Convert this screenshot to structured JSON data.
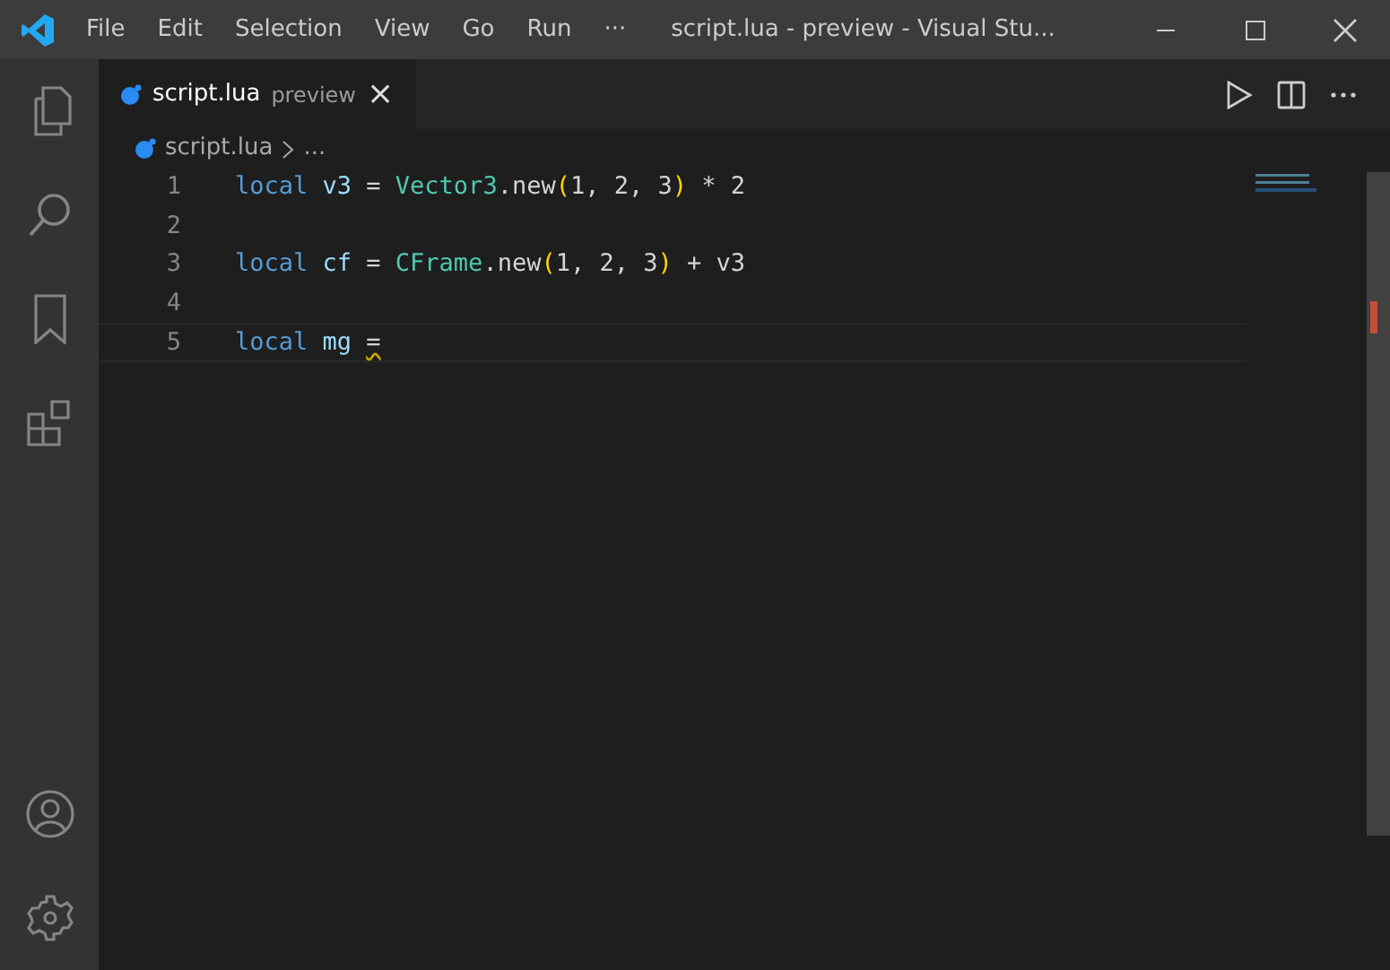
{
  "menu": [
    "File",
    "Edit",
    "Selection",
    "View",
    "Go",
    "Run",
    "···"
  ],
  "window": {
    "title": "script.lua - preview - Visual Stu..."
  },
  "tabs": [
    {
      "name": "script.lua",
      "description": "preview",
      "close": "×",
      "selected": true
    }
  ],
  "breadcrumb": {
    "file": "script.lua",
    "rest": "..."
  },
  "lines": [
    {
      "number": "1",
      "current": false,
      "tokens": [
        {
          "text": "local",
          "kind": "keyword"
        },
        {
          "text": " v3 ",
          "kind": "variable"
        },
        {
          "text": "= ",
          "kind": "plain"
        },
        {
          "text": "Vector3",
          "kind": "class"
        },
        {
          "text": ".new",
          "kind": "plain"
        },
        {
          "text": "(",
          "kind": "bracket"
        },
        {
          "text": "1, 2, 3",
          "kind": "plain"
        },
        {
          "text": ")",
          "kind": "bracket"
        },
        {
          "text": " * 2",
          "kind": "plain"
        }
      ]
    },
    {
      "number": "2",
      "current": false
    },
    {
      "number": "3",
      "current": false,
      "tokens": [
        {
          "text": "local",
          "kind": "keyword"
        },
        {
          "text": " cf ",
          "kind": "variable"
        },
        {
          "text": "= ",
          "kind": "plain"
        },
        {
          "text": "CFrame",
          "kind": "class"
        },
        {
          "text": ".new",
          "kind": "plain"
        },
        {
          "text": "(",
          "kind": "bracket"
        },
        {
          "text": "1, 2, 3",
          "kind": "plain"
        },
        {
          "text": ")",
          "kind": "bracket"
        },
        {
          "text": " + v3",
          "kind": "plain"
        }
      ]
    },
    {
      "number": "4",
      "current": false
    },
    {
      "number": "5",
      "current": true,
      "tokens": [
        {
          "text": "local",
          "kind": "keyword"
        },
        {
          "text": " mg ",
          "kind": "variable"
        },
        {
          "text": "=",
          "kind": "warning"
        }
      ]
    }
  ]
}
